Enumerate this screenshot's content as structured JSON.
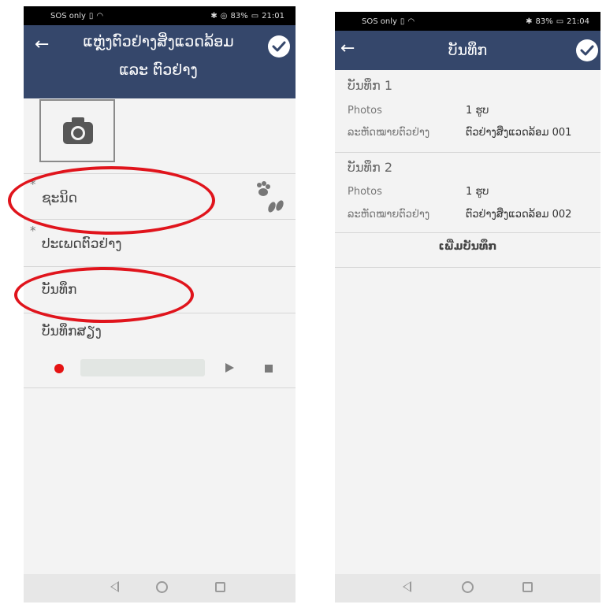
{
  "left_screen": {
    "status": {
      "left": "SOS only",
      "right": "83%",
      "time": "21:01"
    },
    "header": {
      "title_line1": "ແຫຼ່ງຕົວຢ່າງສິ່ງແວດລ້ອມ",
      "title_line2": "ແລະ ຕົວຢ່າງ"
    },
    "fields": {
      "species": {
        "label": "ຊະນິດ",
        "required": "*"
      },
      "sample_type": {
        "label": "ປະເພດຕົວຢ່າງ",
        "required": "*"
      },
      "records": {
        "label": "ບັນທຶກ"
      },
      "audio": {
        "label": "ບັນທຶກສຽງ"
      }
    },
    "icons": {
      "camera": "camera-icon",
      "species_picker": "paw-prints-icon"
    },
    "highlight_color": "#e0141c"
  },
  "right_screen": {
    "status": {
      "left": "SOS only",
      "right": "83%",
      "time": "21:04"
    },
    "header": {
      "title": "ບັນທຶກ"
    },
    "records": [
      {
        "heading": "ບັນທຶກ 1",
        "photos_label": "Photos",
        "photos_value": "1 ຮູບ",
        "code_label": "ລະຫັດໝາຍຕົວຢ່າງ",
        "code_value": "ຕົວຢ່າງສິ່ງແວດລ້ອມ 001"
      },
      {
        "heading": "ບັນທຶກ 2",
        "photos_label": "Photos",
        "photos_value": "1 ຮູບ",
        "code_label": "ລະຫັດໝາຍຕົວຢ່າງ",
        "code_value": "ຕົວຢ່າງສິ່ງແວດລ້ອມ 002"
      }
    ],
    "add_button": "ເພີ່ມບັນທຶກ"
  },
  "colors": {
    "appbar": "#35476b",
    "record_dot": "#e51313",
    "background": "#f3f3f3"
  }
}
